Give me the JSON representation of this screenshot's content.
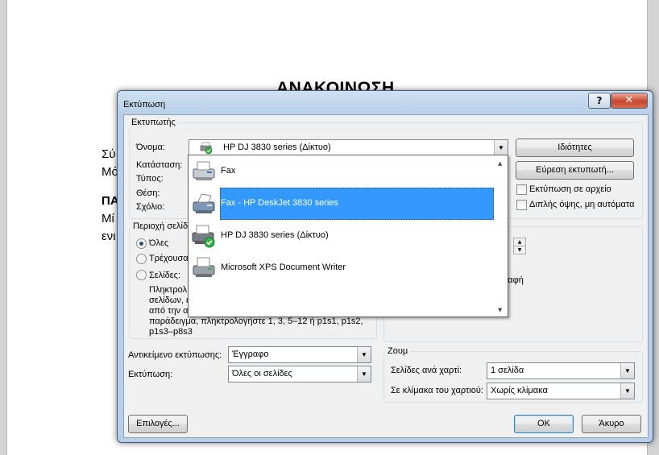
{
  "document": {
    "heading": "ΑΝΑΚΟΙΝΩΣΗ",
    "fragments": [
      "Σύ",
      "Μό",
      "ΠΑ",
      "Μί",
      "ενι"
    ]
  },
  "dialog": {
    "title": "Εκτύπωση",
    "help_label": "?",
    "close_label": "✕",
    "printer_group": {
      "title": "Εκτυπωτής",
      "name_label": "Όνομα:",
      "selected_printer": "HP DJ 3830 series (Δίκτυο)",
      "status_label": "Κατάσταση:",
      "type_label": "Τύπος:",
      "location_label": "Θέση:",
      "comment_label": "Σχόλιο:",
      "properties_button": "Ιδιότητες",
      "find_printer_button": "Εύρεση εκτυπωτή...",
      "print_to_file": "Εκτύπωση σε αρχείο",
      "duplex_manual": "Διπλής όψης, μη αυτόματα"
    },
    "page_range": {
      "title": "Περιοχή σελίδ",
      "all": "Όλες",
      "current": "Τρέχουσα",
      "pages": "Σελίδες:",
      "help_lines": [
        "Πληκτρολ",
        "σελίδων, ε",
        "από την α",
        "παράδειγμα, πληκτρολογήστε 1, 3, 5–12 ή p1s1, p1s2,",
        "p1s3–p8s3"
      ]
    },
    "copies_fragment": "ραφή",
    "print_what_label": "Αντικείμενο εκτύπωσης:",
    "print_what_value": "Έγγραφο",
    "print_label": "Εκτύπωση:",
    "print_value": "Όλες οι σελίδες",
    "zoom": {
      "title": "Ζουμ",
      "pages_per_sheet_label": "Σελίδες ανά χαρτί:",
      "pages_per_sheet_value": "1 σελίδα",
      "scale_label": "Σε κλίμακα του χαρτιού:",
      "scale_value": "Χωρίς κλίμακα"
    },
    "options_button": "Επιλογές...",
    "ok_button": "OK",
    "cancel_button": "Άκυρο"
  },
  "printer_list": {
    "items": [
      {
        "label": "Fax",
        "icon": "fax-printer-icon"
      },
      {
        "label": "Fax - HP DeskJet 3830 series",
        "icon": "fax-printer-icon"
      },
      {
        "label": "HP DJ 3830 series (Δίκτυο)",
        "icon": "default-printer-icon"
      },
      {
        "label": "Microsoft XPS Document Writer",
        "icon": "printer-icon"
      }
    ],
    "selected_index": 1,
    "highlight_color": "#3399ff"
  }
}
